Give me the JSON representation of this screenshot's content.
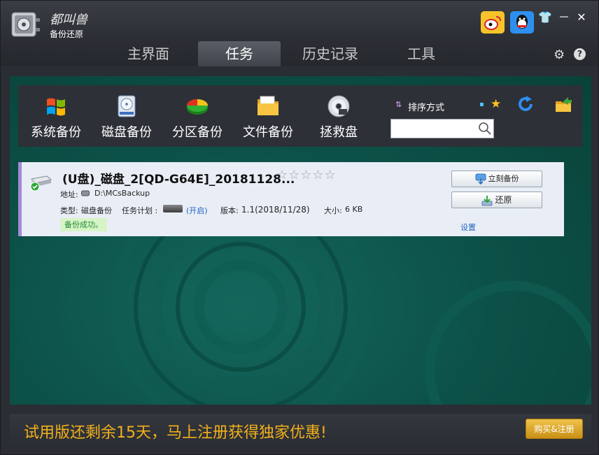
{
  "app": {
    "name_cursive": "都叫兽",
    "name": "备份还原",
    "icons": {
      "logo": "safe-icon",
      "weibo": "weibo-icon",
      "qq": "qq-icon",
      "skin": "skin-icon",
      "minimize": "minimize-icon",
      "close": "close-icon"
    },
    "minimize_glyph": "－",
    "close_glyph": "✕",
    "skin_glyph": "👕"
  },
  "tabs": [
    {
      "label": "主界面",
      "active": false
    },
    {
      "label": "任务",
      "active": true
    },
    {
      "label": "历史记录",
      "active": false
    },
    {
      "label": "工具",
      "active": false
    }
  ],
  "header_icons": {
    "settings": "⚙",
    "help": "?"
  },
  "toolbar": {
    "items": [
      {
        "label": "系统备份",
        "icon": "windows-flag-icon"
      },
      {
        "label": "磁盘备份",
        "icon": "hard-disk-icon"
      },
      {
        "label": "分区备份",
        "icon": "pie-partition-icon"
      },
      {
        "label": "文件备份",
        "icon": "folder-icon"
      },
      {
        "label": "拯救盘",
        "icon": "cd-disc-icon"
      }
    ],
    "sort_icon_glyph": "⇅",
    "sort_label": "排序方式",
    "dot_glyph": "▪",
    "star_glyph": "★",
    "search": {
      "placeholder": "",
      "value": ""
    }
  },
  "task": {
    "title": "(U盘)_磁盘_2[QD-G64E]_20181128...",
    "rating_stars": "☆☆☆☆☆",
    "rating_value": 0,
    "address_label": "地址:",
    "address_value": "D:\\MCsBackup",
    "type_label": "类型:",
    "type_value": "磁盘备份",
    "schedule_label": "任务计划 :",
    "schedule_state": "(开启)",
    "version_label": "版本:",
    "version_value": "1.1(2018/11/28)",
    "size_label": "大小:",
    "size_value": "6 KB",
    "status": "备份成功。",
    "backup_now_label": "立刻备份",
    "restore_label": "还原",
    "settings_label": "设置"
  },
  "footer": {
    "promo": "试用版还剩余15天，马上注册获得独家优惠!",
    "buy_label": "购买&注册"
  },
  "colors": {
    "accent": "#f3b11a",
    "card_border": "#a58ad8",
    "link": "#2264c2",
    "bg": "#0c5148"
  }
}
